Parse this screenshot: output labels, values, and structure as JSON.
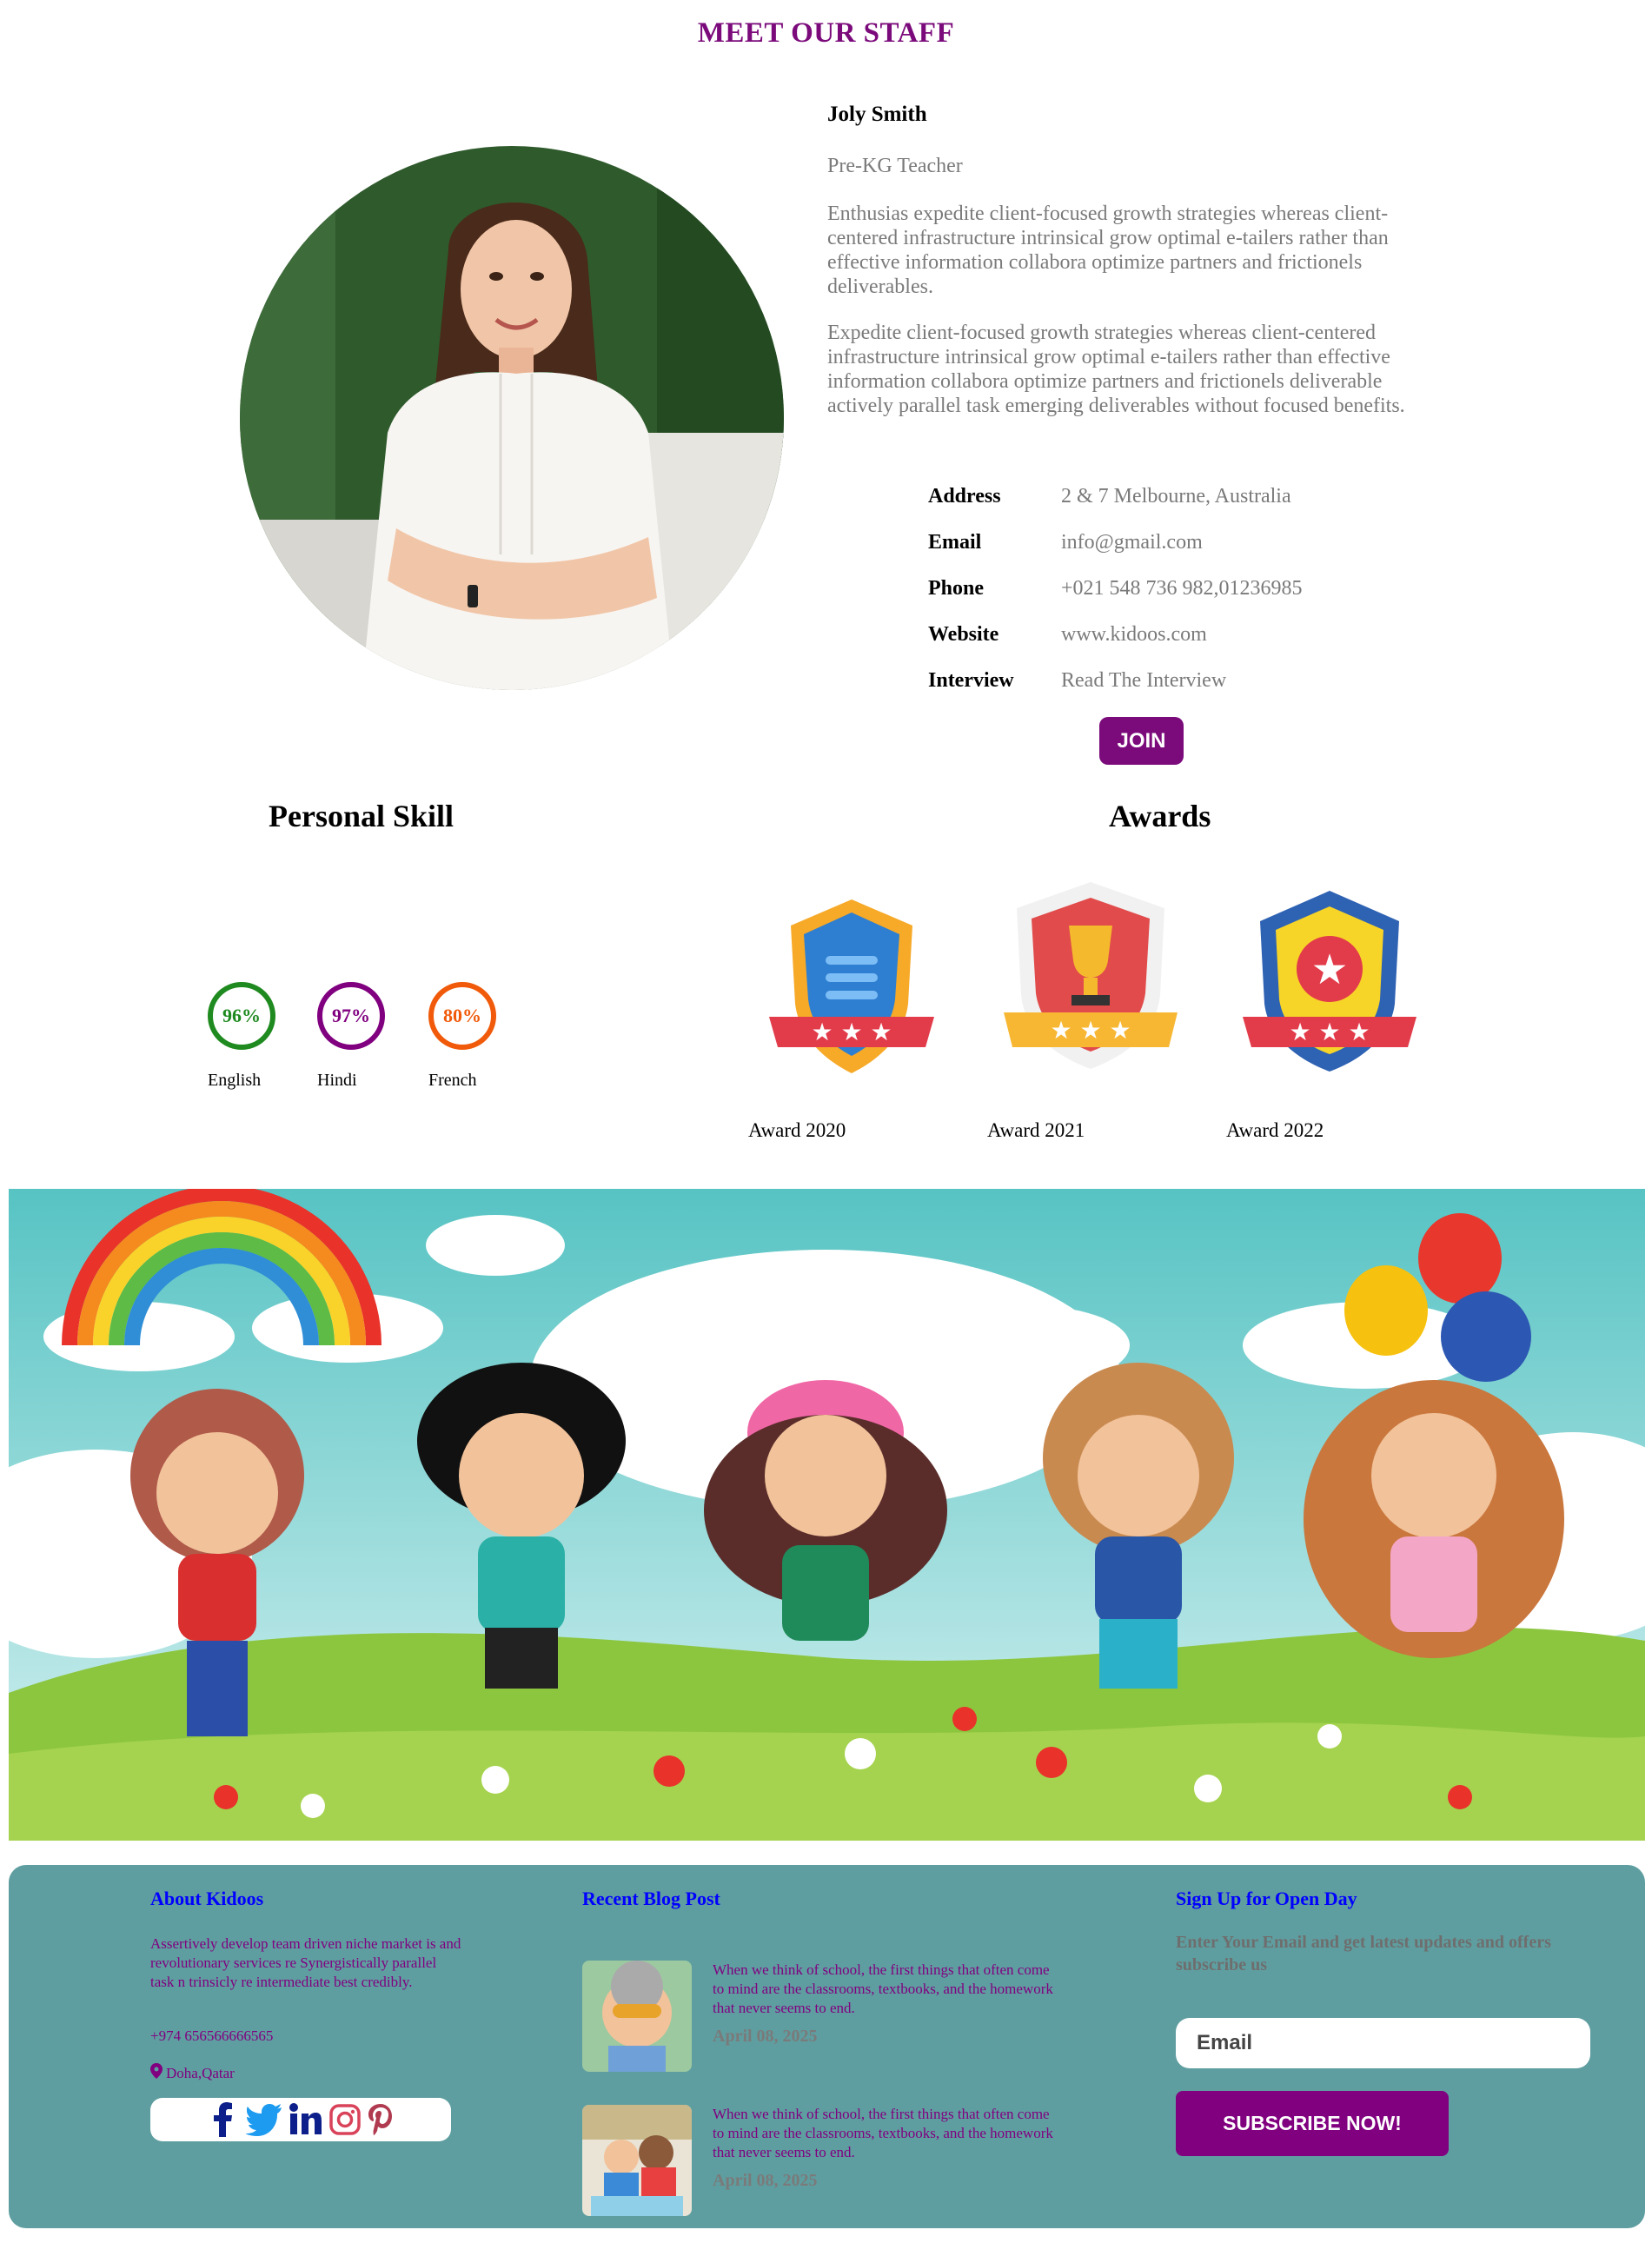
{
  "page": {
    "title": "MEET OUR STAFF"
  },
  "staff": {
    "name": "Joly Smith",
    "role": "Pre-KG Teacher",
    "bio_1": "Enthusias expedite client-focused growth strategies whereas client-centered infrastructure intrinsical grow optimal e-tailers rather than effective information collabora optimize partners and frictionels deliverables.",
    "bio_2": "Expedite client-focused growth strategies whereas client-centered infrastructure intrinsical grow optimal e-tailers rather than effective information collabora optimize partners and frictionels deliverable actively parallel task emerging deliverables without focused benefits.",
    "details": [
      {
        "label": "Address",
        "value": "2 & 7 Melbourne, Australia"
      },
      {
        "label": "Email",
        "value": "info@gmail.com"
      },
      {
        "label": "Phone",
        "value": "+021 548 736 982,01236985"
      },
      {
        "label": "Website",
        "value": "www.kidoos.com"
      },
      {
        "label": "Interview",
        "value": "Read The Interview"
      }
    ],
    "join_label": "JOIN"
  },
  "skills": {
    "title": "Personal Skill",
    "items": [
      {
        "percent": "96%",
        "label": "English",
        "color": "#1f8a1f"
      },
      {
        "percent": "97%",
        "label": "Hindi",
        "color": "#800080"
      },
      {
        "percent": "80%",
        "label": "French",
        "color": "#f05a0a"
      }
    ]
  },
  "awards": {
    "title": "Awards",
    "items": [
      {
        "label": "Award 2020"
      },
      {
        "label": "Award 2021"
      },
      {
        "label": "Award 2022"
      }
    ]
  },
  "footer": {
    "about": {
      "heading": "About Kidoos",
      "text": "Assertively develop team driven niche market is and revolutionary services re Synergistically parallel task n trinsicly re intermediate best credibly.",
      "phone": "+974 656566666565",
      "location": "Doha,Qatar",
      "social": [
        "facebook-icon",
        "twitter-icon",
        "linkedin-icon",
        "instagram-icon",
        "pinterest-icon"
      ]
    },
    "blog": {
      "heading": "Recent Blog Post",
      "posts": [
        {
          "text": "When we think of school, the first things that often come to mind are the classrooms, textbooks, and the homework that never seems to end.",
          "date": "April 08, 2025"
        },
        {
          "text": "When we think of school, the first things that often come to mind are the classrooms, textbooks, and the homework that never seems to end.",
          "date": "April 08, 2025"
        }
      ]
    },
    "signup": {
      "heading": "Sign Up for Open Day",
      "text": "Enter Your Email and get latest updates and offers subscribe us",
      "email_placeholder": "Email",
      "button_label": "SUBSCRIBE NOW!"
    }
  },
  "colors": {
    "accent": "#7b0a7b",
    "footer_bg": "#5f9ea0",
    "link_blue": "#0000ff"
  }
}
